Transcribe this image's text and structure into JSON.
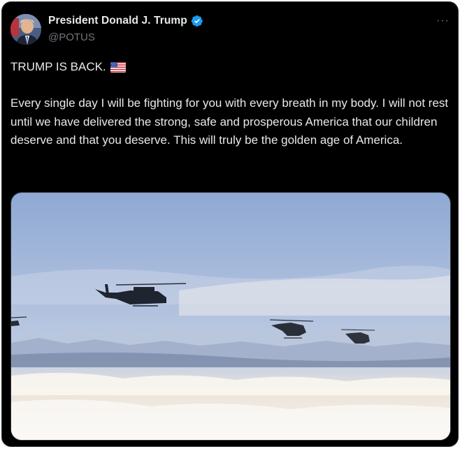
{
  "author": {
    "display_name": "President Donald J. Trump",
    "handle": "@POTUS",
    "verified_badge_icon": "verified-badge-icon",
    "avatar": "avatar"
  },
  "menu": {
    "more_label": "···",
    "more_icon": "more-options-icon"
  },
  "tweet": {
    "headline": "TRUMP IS BACK.",
    "headline_emoji_icon": "us-flag-icon",
    "body": "Every single day I will be fighting for you with every breath in my body. I will not rest until we have delivered the strong, safe and prosperous America that our children deserve and that you deserve. This will truly be the golden age of America."
  },
  "media": {
    "type": "image",
    "subject": "helicopters-over-clouds"
  },
  "colors": {
    "background": "#000000",
    "primary_text": "#e7e9ea",
    "secondary_text": "#71767b",
    "verified_blue": "#1d9bf0",
    "border": "#2f3336"
  }
}
